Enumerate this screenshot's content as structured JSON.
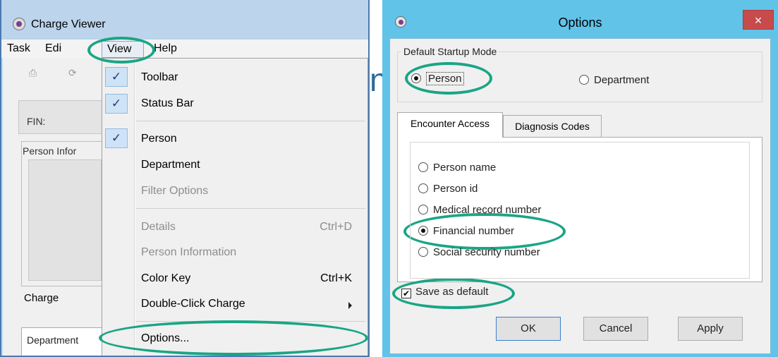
{
  "charge_viewer": {
    "title": "Charge Viewer",
    "menubar": {
      "task": "Task",
      "edit": "Edi",
      "view": "View",
      "help": "Help"
    },
    "fin_label": "FIN:",
    "person_info_label": "Person Infor",
    "charge_label": "Charge",
    "department_col": "Department",
    "toolbar_icons": [
      "print-icon",
      "refresh-icon"
    ]
  },
  "view_menu": {
    "items": [
      {
        "label": "Toolbar",
        "checked": true,
        "enabled": true,
        "shortcut": ""
      },
      {
        "label": "Status Bar",
        "checked": true,
        "enabled": true,
        "shortcut": ""
      },
      {
        "label": "Person",
        "checked": true,
        "enabled": true,
        "shortcut": ""
      },
      {
        "label": "Department",
        "checked": false,
        "enabled": true,
        "shortcut": ""
      },
      {
        "label": "Filter Options",
        "checked": false,
        "enabled": false,
        "shortcut": ""
      },
      {
        "label": "Details",
        "checked": false,
        "enabled": false,
        "shortcut": "Ctrl+D"
      },
      {
        "label": "Person Information",
        "checked": false,
        "enabled": false,
        "shortcut": ""
      },
      {
        "label": "Color Key",
        "checked": false,
        "enabled": true,
        "shortcut": "Ctrl+K"
      },
      {
        "label": "Double-Click Charge",
        "checked": false,
        "enabled": true,
        "shortcut": "",
        "submenu": true
      },
      {
        "label": "Options...",
        "checked": false,
        "enabled": true,
        "shortcut": ""
      }
    ],
    "check_glyph": "✓"
  },
  "options_dialog": {
    "title": "Options",
    "close_glyph": "×",
    "startup_mode": {
      "legend": "Default Startup Mode",
      "person": "Person",
      "department": "Department",
      "selected": "Person"
    },
    "tabs": [
      "Encounter Access",
      "Diagnosis Codes"
    ],
    "active_tab": "Encounter Access",
    "encounter_access": {
      "options": [
        "Person name",
        "Person id",
        "Medical record number",
        "Financial number",
        "Social security number"
      ],
      "selected": "Financial number"
    },
    "save_default": {
      "label": "Save as default",
      "checked": true,
      "check_glyph": "✔"
    },
    "buttons": {
      "ok": "OK",
      "cancel": "Cancel",
      "apply": "Apply"
    }
  },
  "background_glyph": "n",
  "highlight_color": "#1aa585"
}
